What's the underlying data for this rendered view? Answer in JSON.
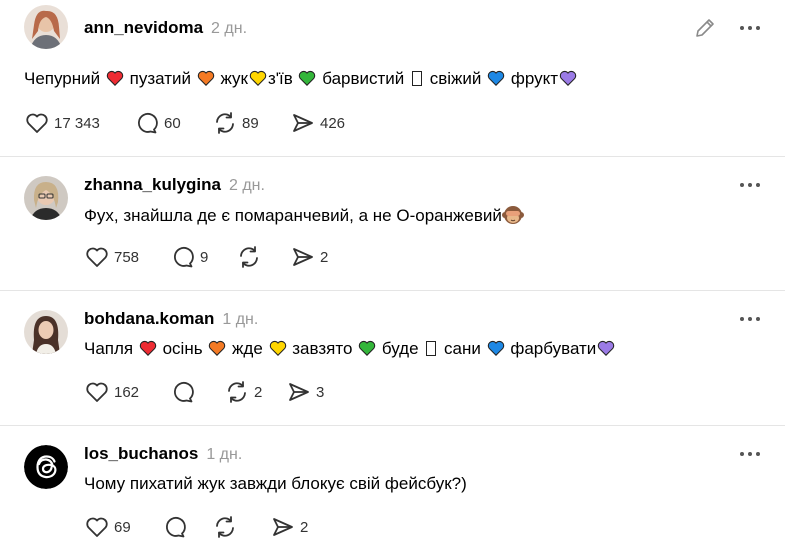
{
  "colors": {
    "red": "#ee2c33",
    "orange": "#f47a24",
    "yellow": "#ffd600",
    "green": "#33b63a",
    "blue": "#1e88e5",
    "purple": "#9b7be6",
    "muted": "#999999"
  },
  "posts": [
    {
      "username": "ann_nevidoma",
      "time": "2 дн.",
      "words": [
        "Чепурний",
        "пузатий",
        "жук",
        "з'їв",
        "барвистий",
        "свіжий",
        "фрукт"
      ],
      "likes": "17 343",
      "replies": "60",
      "reposts": "89",
      "shares": "426"
    },
    {
      "username": "zhanna_kulygina",
      "time": "2 дн.",
      "text": "Фух, знайшла де є помаранчевий, а не О-оранжевий",
      "likes": "758",
      "replies": "9",
      "shares": "2"
    },
    {
      "username": "bohdana.koman",
      "time": "1 дн.",
      "words": [
        "Чапля",
        "осінь",
        "жде",
        "завзято",
        "буде",
        "сани",
        "фарбувати"
      ],
      "likes": "162",
      "reposts": "2",
      "shares": "3"
    },
    {
      "username": "los_buchanos",
      "time": "1 дн.",
      "text": "Чому пихатий жук завжди блокує свій фейсбук?)",
      "likes": "69",
      "shares": "2"
    }
  ]
}
